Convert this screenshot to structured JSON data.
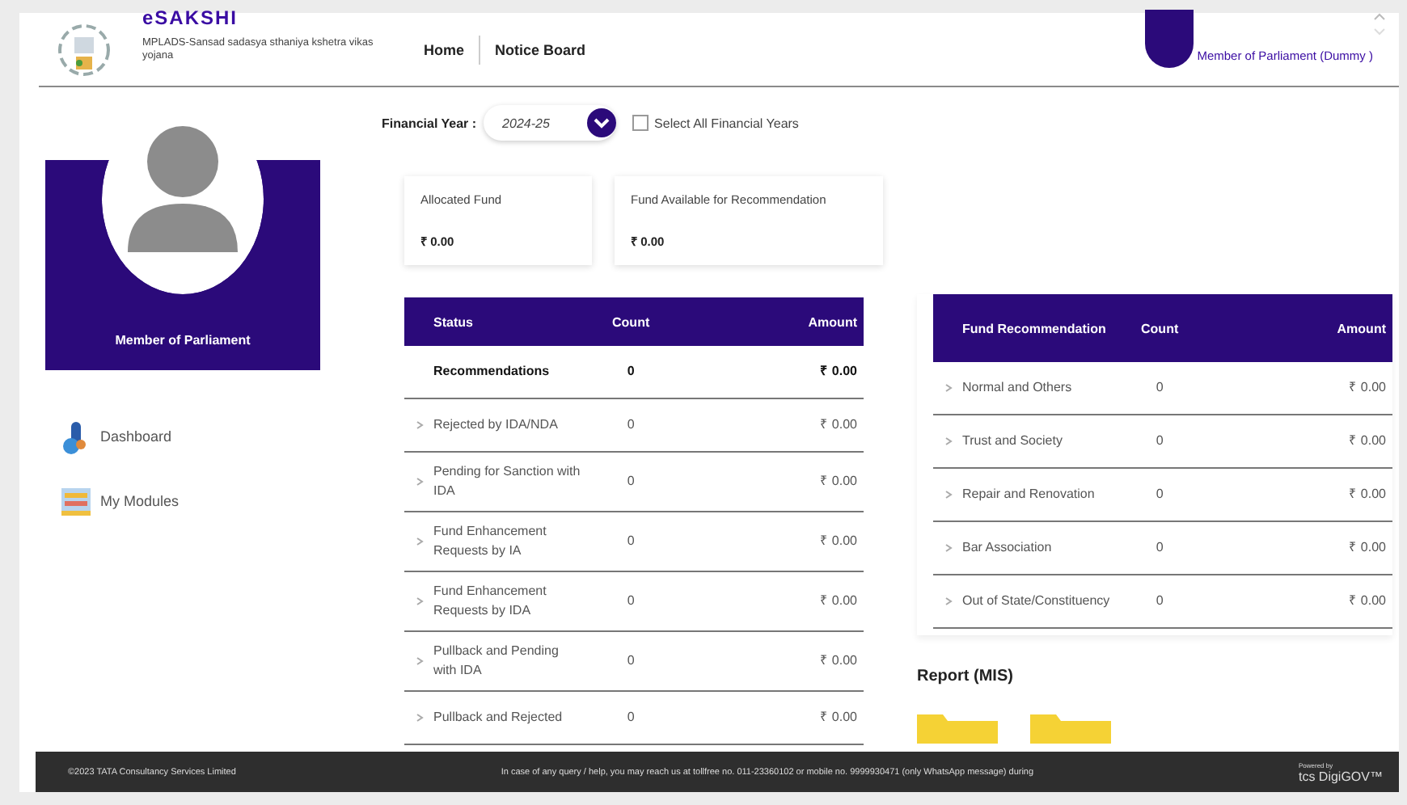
{
  "header": {
    "app_name": "eSAKSHI",
    "subtitle": "MPLADS-Sansad sadasya sthaniya kshetra vikas yojana",
    "nav": [
      {
        "label": "Home"
      },
      {
        "label": "Notice Board"
      }
    ],
    "user": "Member of Parliament (Dummy )"
  },
  "sidebar": {
    "profile_label": "Member of Parliament",
    "items": [
      {
        "label": "Dashboard",
        "kind": "dashboard"
      },
      {
        "label": "My Modules",
        "kind": "modules"
      }
    ]
  },
  "filter": {
    "label": "Financial Year :",
    "value": "2024-25",
    "select_all": {
      "label": "Select All Financial Years",
      "checked": false
    }
  },
  "fund_cards": [
    {
      "label": "Allocated Fund",
      "value": "₹ 0.00"
    },
    {
      "label": "Fund Available for Recommendation",
      "value": "₹ 0.00"
    }
  ],
  "status_table": {
    "columns": [
      "Status",
      "Count",
      "Amount"
    ],
    "rows": [
      {
        "kind": "summary",
        "status": "Recommendations",
        "count": "0",
        "amount": "₹ 0.00"
      },
      {
        "kind": "item",
        "status": "Rejected by IDA/NDA",
        "count": "0",
        "amount": "₹ 0.00"
      },
      {
        "kind": "item",
        "status": "Pending for Sanction with IDA",
        "count": "0",
        "amount": "₹ 0.00"
      },
      {
        "kind": "item",
        "status": "Fund Enhancement Requests by IA",
        "count": "0",
        "amount": "₹ 0.00"
      },
      {
        "kind": "item",
        "status": "Fund Enhancement Requests by IDA",
        "count": "0",
        "amount": "₹ 0.00"
      },
      {
        "kind": "item",
        "status": "Pullback and Pending with IDA",
        "count": "0",
        "amount": "₹ 0.00"
      },
      {
        "kind": "item",
        "status": "Pullback and Rejected",
        "count": "0",
        "amount": "₹ 0.00"
      }
    ]
  },
  "fund_table": {
    "columns": [
      "Fund Recommendation",
      "Count",
      "Amount"
    ],
    "rows": [
      {
        "kind": "item",
        "status": "Normal and Others",
        "count": "0",
        "amount": "₹ 0.00"
      },
      {
        "kind": "item",
        "status": "Trust and Society",
        "count": "0",
        "amount": "₹ 0.00"
      },
      {
        "kind": "item",
        "status": "Repair and Renovation",
        "count": "0",
        "amount": "₹ 0.00"
      },
      {
        "kind": "item",
        "status": "Bar Association",
        "count": "0",
        "amount": "₹ 0.00"
      },
      {
        "kind": "item",
        "status": "Out of State/Constituency",
        "count": "0",
        "amount": "₹ 0.00"
      }
    ]
  },
  "report": {
    "title": "Report (MIS)"
  },
  "footer": {
    "copyright": "©2023 TATA Consultancy Services Limited",
    "notice": "In case of any query / help, you may reach us at tollfree no. 011-23360102 or mobile no. 9999930471 (only WhatsApp message) during",
    "powered_by": "Powered by",
    "brand": "tcs DigiGOV™"
  }
}
